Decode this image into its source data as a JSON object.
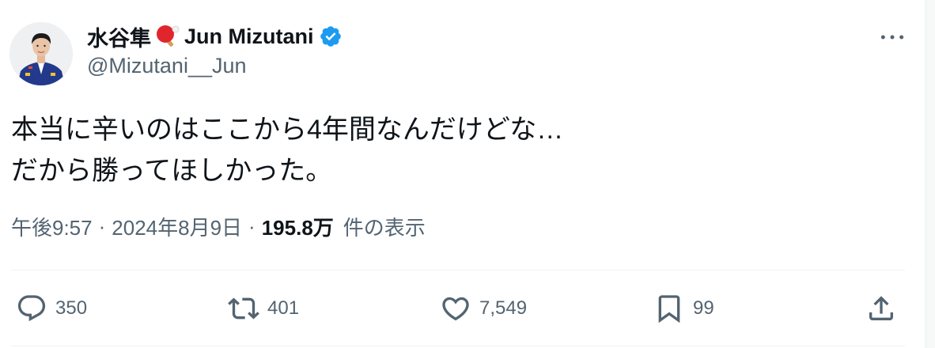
{
  "author": {
    "display_name": "水谷隼",
    "display_name_suffix": "Jun Mizutani",
    "handle": "@Mizutani__Jun",
    "verified": true,
    "verified_color": "#1d9bf0",
    "avatar_icon": "profile-photo",
    "name_emoji_icon": "ping-pong-paddle-icon"
  },
  "tweet": {
    "lines": [
      "本当に辛いのはここから4年間なんだけどな…",
      "だから勝ってほしかった。"
    ]
  },
  "meta": {
    "time": "午後9:57",
    "separator": "·",
    "date": "2024年8月9日",
    "views_count": "195.8万",
    "views_label": "件の表示"
  },
  "actions": {
    "reply": {
      "icon": "reply-icon",
      "count": "350"
    },
    "retweet": {
      "icon": "retweet-icon",
      "count": "401"
    },
    "like": {
      "icon": "heart-icon",
      "count": "7,549"
    },
    "bookmark": {
      "icon": "bookmark-icon",
      "count": "99"
    },
    "share": {
      "icon": "share-icon"
    }
  },
  "more": {
    "icon": "more-dots-icon"
  },
  "colors": {
    "text": "#0f1419",
    "secondary": "#536471",
    "divider": "#eff3f4"
  }
}
